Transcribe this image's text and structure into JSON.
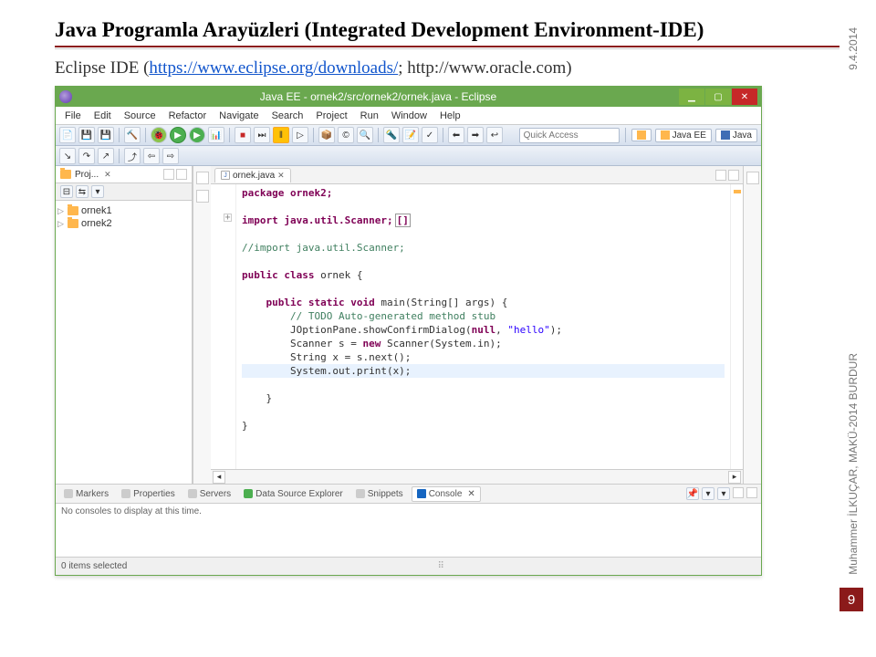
{
  "slide": {
    "title": "Java Programla  Arayüzleri (Integrated Development Environment-IDE)",
    "subtitle_prefix": "Eclipse  IDE (",
    "subtitle_link": "https://www.eclipse.org/downloads/",
    "subtitle_suffix": ";   http://www.oracle.com)",
    "date": "9.4.2014",
    "author": "Muhammer İLKUÇAR, MAKÜ-2014  BURDUR",
    "page": "9"
  },
  "window": {
    "title": "Java EE - ornek2/src/ornek2/ornek.java - Eclipse",
    "min": "▁",
    "max": "▢",
    "close": "✕"
  },
  "menu": [
    "File",
    "Edit",
    "Source",
    "Refactor",
    "Navigate",
    "Search",
    "Project",
    "Run",
    "Window",
    "Help"
  ],
  "quick_access": {
    "placeholder": "Quick Access"
  },
  "perspectives": {
    "javaee": "Java EE",
    "java": "Java"
  },
  "project_view": {
    "tab": "Proj...",
    "items": [
      "ornek1",
      "ornek2"
    ]
  },
  "editor": {
    "tab": "ornek.java",
    "code": {
      "l1": "package ornek2;",
      "l2": "",
      "l3_a": "import",
      "l3_b": " java.util.Scanner;",
      "l3_box": "[]",
      "l4": "",
      "l5": "//import java.util.Scanner;",
      "l6": "",
      "l7_a": "public class",
      "l7_b": " ornek {",
      "l8": "",
      "l9_a": "    public static void",
      "l9_b": " main(String[] args) {",
      "l10": "        // TODO Auto-generated method stub",
      "l11_a": "        JOptionPane.showConfirmDialog(",
      "l11_b": "null",
      "l11_c": ", ",
      "l11_d": "\"hello\"",
      "l11_e": ");",
      "l12_a": "        Scanner s = ",
      "l12_b": "new",
      "l12_c": " Scanner(System.in);",
      "l13": "        String x = s.next();",
      "l14": "        System.out.print(x);",
      "l15": "",
      "l16": "    }",
      "l17": "",
      "l18": "}"
    }
  },
  "bottom": {
    "tabs": {
      "markers": "Markers",
      "properties": "Properties",
      "servers": "Servers",
      "dse": "Data Source Explorer",
      "snippets": "Snippets",
      "console": "Console"
    },
    "console_text": "No consoles to display at this time."
  },
  "status": {
    "text": "0 items selected"
  }
}
